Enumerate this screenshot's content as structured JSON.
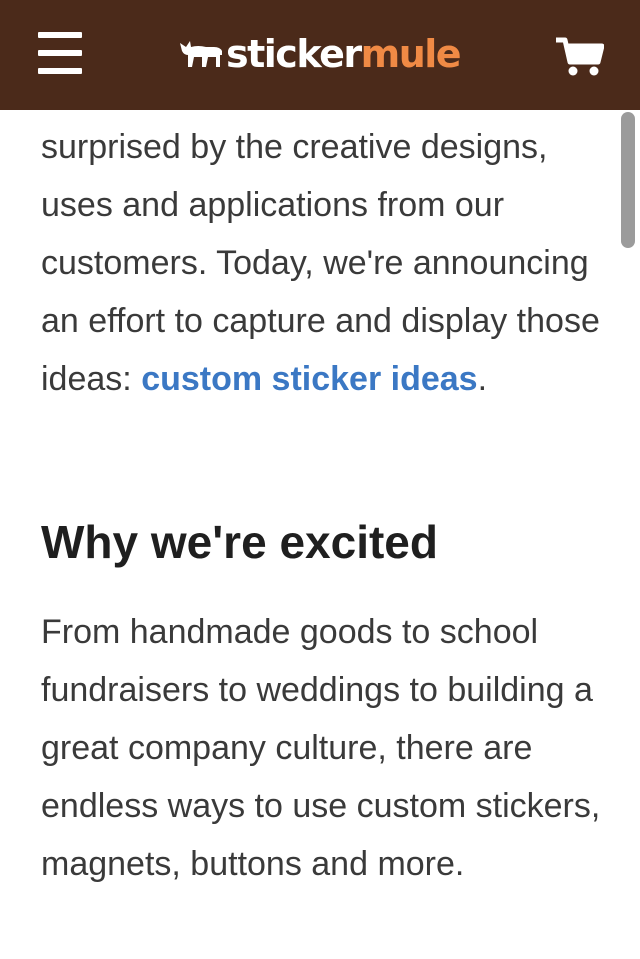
{
  "header": {
    "logo_prefix": "sticker",
    "logo_suffix": "mule",
    "colors": {
      "background": "#4b2a1a",
      "logo_accent": "#f08a45"
    }
  },
  "article": {
    "intro_text": "surprised by the creative designs, uses and applications from our customers. Today, we're announcing an effort to capture and display those ideas: ",
    "intro_link": "custom sticker ideas",
    "intro_end": ".",
    "heading": "Why we're excited",
    "body_text": "From handmade goods to school fundraisers to weddings to building a great company culture, there are endless ways to use custom stickers, magnets, buttons and more.",
    "link_color": "#3b78c4"
  },
  "icons": {
    "menu": "hamburger-menu-icon",
    "logo": "mule-logo-icon",
    "cart": "shopping-cart-icon"
  }
}
